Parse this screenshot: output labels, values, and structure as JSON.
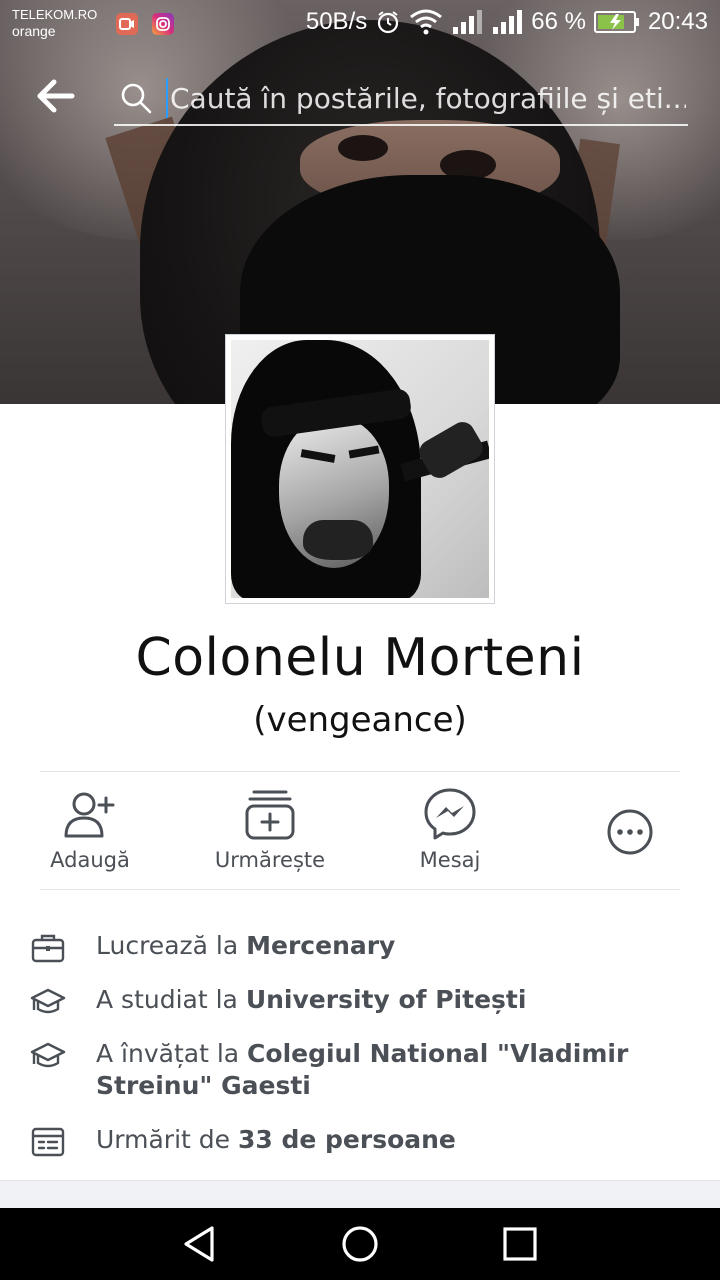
{
  "status_bar": {
    "carrier_line1": "TELEKOM.RO",
    "carrier_line2": "orange",
    "speed": "50B/s",
    "battery_percent": "66 %",
    "time": "20:43"
  },
  "search": {
    "placeholder": "Caută în postările, fotografiile și eti..."
  },
  "profile": {
    "name": "Colonelu Morteni",
    "alternate_name": "(vengeance)"
  },
  "actions": [
    {
      "label": "Adaugă",
      "icon": "add-friend-icon"
    },
    {
      "label": "Urmărește",
      "icon": "follow-icon"
    },
    {
      "label": "Mesaj",
      "icon": "messenger-icon"
    },
    {
      "label": "",
      "icon": "more-icon"
    }
  ],
  "info": {
    "work_prefix": "Lucrează la ",
    "work_place": "Mercenary",
    "study_prefix": "A studiat la ",
    "study_place": "University of Pitești",
    "school_prefix": "A învățat la ",
    "school_place": "Colegiul National \"Vladimir Streinu\" Gaesti",
    "followers_prefix": "Urmărit de ",
    "followers_value": "33 de persoane"
  },
  "colors": {
    "icon_gray": "#4b4f56",
    "divider": "#e3e4e8",
    "cursor_blue": "#2a9cff"
  }
}
